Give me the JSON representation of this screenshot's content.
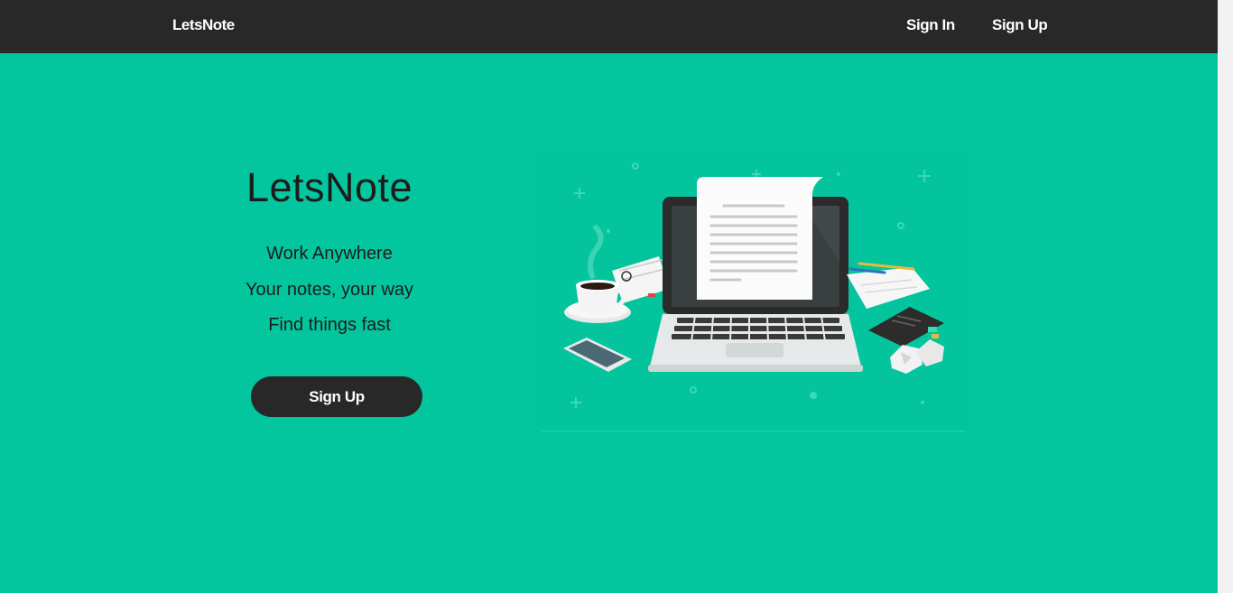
{
  "navbar": {
    "brand": "LetsNote",
    "links": [
      {
        "label": "Sign In"
      },
      {
        "label": "Sign Up"
      }
    ]
  },
  "hero": {
    "title": "LetsNote",
    "taglines": [
      "Work Anywhere",
      "Your notes, your way",
      "Find things fast"
    ],
    "cta_label": "Sign Up"
  },
  "colors": {
    "background": "#04c69e",
    "navbar": "#282828",
    "button": "#282828",
    "text_light": "#ffffff",
    "text_dark": "#1c1c1c"
  },
  "illustration": {
    "icons": [
      "laptop-icon",
      "document-icon",
      "coffee-cup-icon",
      "smartphone-icon",
      "notebook-icon",
      "pencil-icon",
      "crumpled-paper-icon"
    ]
  }
}
